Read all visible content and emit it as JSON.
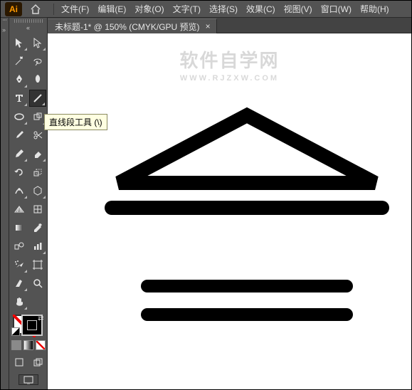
{
  "app": {
    "logo_text": "Ai"
  },
  "menu": {
    "file": "文件(F)",
    "edit": "编辑(E)",
    "object": "对象(O)",
    "type": "文字(T)",
    "select": "选择(S)",
    "effect": "效果(C)",
    "view": "视图(V)",
    "window": "窗口(W)",
    "help": "帮助(H)"
  },
  "tab": {
    "title": "未标题-1* @ 150% (CMYK/GPU 预览)",
    "close": "×"
  },
  "tooltip": {
    "text": "直线段工具 (\\)"
  },
  "watermark": {
    "line1": "软件自学网",
    "line2": "WWW.RJZXW.COM"
  },
  "tools": {
    "selection": "selection",
    "direct_selection": "direct-selection",
    "magic_wand": "magic-wand",
    "lasso": "lasso",
    "pen": "pen",
    "curvature_pen": "curvature-pen",
    "type": "type",
    "line_segment": "line-segment",
    "rectangle": "rectangle",
    "shape_builder": "shape-builder",
    "paintbrush": "paintbrush",
    "scissors": "scissors",
    "pencil": "pencil",
    "eraser": "eraser",
    "rotate": "rotate",
    "scale": "scale",
    "width": "width",
    "free_transform": "free-transform",
    "perspective": "perspective",
    "mesh": "mesh",
    "gradient": "gradient",
    "eyedropper": "eyedropper",
    "blend": "blend",
    "column_graph": "column-graph",
    "symbol_sprayer": "symbol-sprayer",
    "artboard": "artboard",
    "slice": "slice",
    "zoom": "zoom",
    "hand": "hand"
  },
  "colors": {
    "ui_bg": "#535353",
    "accent": "#ff9a00"
  }
}
